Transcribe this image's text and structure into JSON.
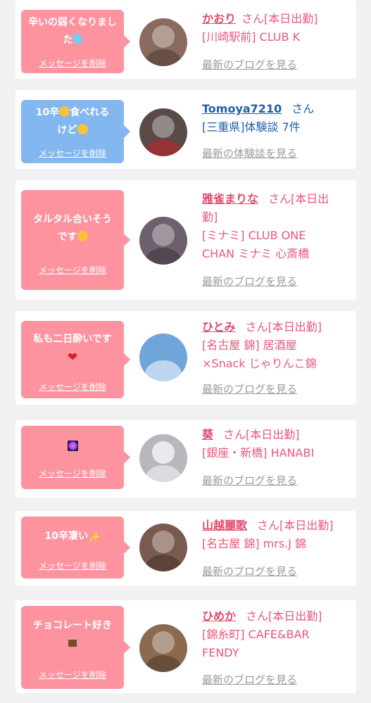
{
  "cards": [
    {
      "message": "辛いの弱くなりました",
      "message_emoji": "sweat-droplets-icon",
      "delete_label": "メッセージを削除",
      "name": "かおり",
      "suffix": "さん[本日出勤]",
      "detail": "[川崎駅前] CLUB K",
      "link": "最新のブログを見る",
      "bubble_color": "#fe93a0",
      "avatar_color": "#8a6a5e"
    },
    {
      "message_line1": "10辛",
      "message_line1b": "食べれる",
      "message_line2": "けど",
      "delete_label": "メッセージを削除",
      "name": "Tomoya7210",
      "suffix": "さん",
      "detail": "[三重県]体験談 7件",
      "link": "最新の体験談を見る",
      "bubble_color": "#82b7f0",
      "avatar_color": "#5a4a48"
    },
    {
      "message_line1": "タルタル合いそう",
      "message_line2": "です",
      "delete_label": "メッセージを削除",
      "name": "雅雀まりな",
      "suffix": "さん[本日出",
      "suffix2": "勤]",
      "detail": "[ミナミ] CLUB ONE",
      "detail2": "CHAN ミナミ 心斎橋",
      "link": "最新のブログを見る",
      "bubble_color": "#fe93a0",
      "avatar_color": "#6e5f6c"
    },
    {
      "message_line1": "私も二日酔いです",
      "delete_label": "メッセージを削除",
      "name": "ひとみ",
      "suffix": "さん[本日出勤]",
      "detail": "[名古屋 錦] 居酒屋",
      "detail2": "×Snack じゃりんこ錦",
      "link": "最新のブログを見る",
      "bubble_color": "#fe93a0",
      "avatar_color": "#6fa5d8"
    },
    {
      "delete_label": "メッセージを削除",
      "name": "葵",
      "suffix": "さん[本日出勤]",
      "detail": "[銀座・新橋] HANABI",
      "link": "最新のブログを見る",
      "bubble_color": "#fe93a0",
      "avatar_color": "#b9b6bd"
    },
    {
      "message_line1": "10辛凄い",
      "delete_label": "メッセージを削除",
      "name": "山越麗歌",
      "suffix": "さん[本日出勤]",
      "detail": "[名古屋 錦] mrs.J 錦",
      "link": "最新のブログを見る",
      "bubble_color": "#fe93a0",
      "avatar_color": "#7a5a4e"
    },
    {
      "message_line1": "チョコレート好き",
      "delete_label": "メッセージを削除",
      "name": "ひめか",
      "suffix": "さん[本日出勤]",
      "detail": "[錦糸町] CAFE&BAR",
      "detail2": "FENDY",
      "link": "最新のブログを見る",
      "bubble_color": "#fe93a0",
      "avatar_color": "#8b6a50"
    }
  ]
}
